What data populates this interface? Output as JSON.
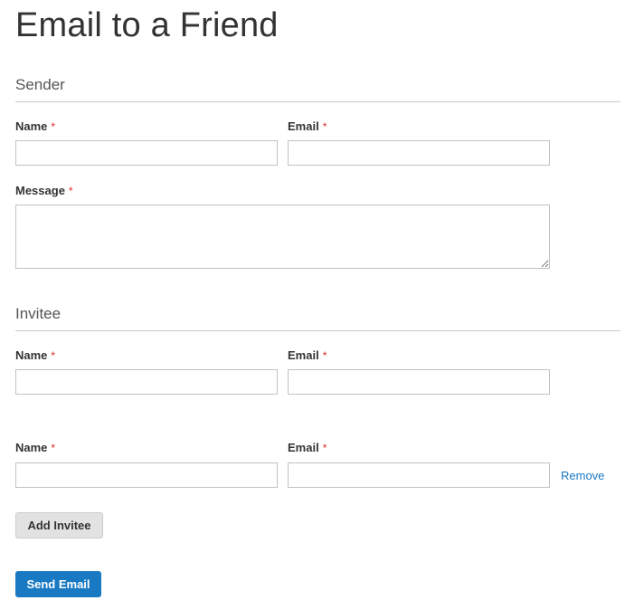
{
  "page": {
    "title": "Email to a Friend"
  },
  "sender": {
    "legend": "Sender",
    "name_label": "Name",
    "email_label": "Email",
    "message_label": "Message",
    "required_marker": "*",
    "name_value": "",
    "email_value": "",
    "message_value": ""
  },
  "invitee": {
    "legend": "Invitee",
    "rows": [
      {
        "name_label": "Name",
        "email_label": "Email",
        "name_value": "",
        "email_value": ""
      },
      {
        "name_label": "Name",
        "email_label": "Email",
        "name_value": "",
        "email_value": "",
        "remove_label": "Remove"
      }
    ],
    "required_marker": "*"
  },
  "actions": {
    "add_invitee_label": "Add Invitee",
    "send_email_label": "Send Email"
  },
  "colors": {
    "primary": "#1979c3",
    "required": "#e02b27",
    "secondary_button": "#e2e2e2"
  }
}
